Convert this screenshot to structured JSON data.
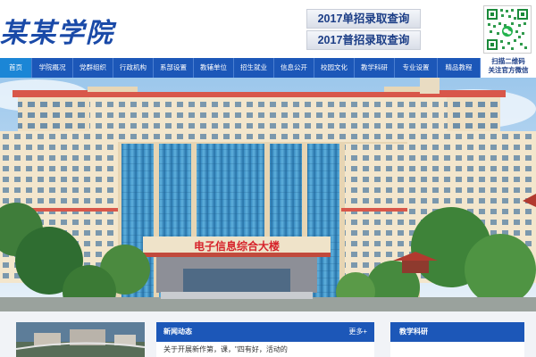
{
  "header": {
    "logo_text": "某某学院",
    "query_buttons": [
      "2017单招录取查询",
      "2017普招录取查询"
    ],
    "qr_caption_line1": "扫描二维码",
    "qr_caption_line2": "关注官方微信"
  },
  "nav": {
    "items": [
      "首页",
      "学院概况",
      "党群组织",
      "行政机构",
      "系部设置",
      "教辅单位",
      "招生就业",
      "信息公开",
      "校园文化",
      "教学科研",
      "专业设置",
      "精品教程"
    ],
    "active_index": 0
  },
  "banner": {
    "building_sign": "电子信息综合大楼"
  },
  "news": {
    "title": "新闻动态",
    "more": "更多+",
    "first_line": "关于开展新作第，课，\"四有好，活动的"
  },
  "teaching": {
    "title": "教学科研"
  },
  "colors": {
    "nav_blue": "#1c57b8",
    "nav_active": "#1b86d6",
    "accent_text": "#1b3d86"
  }
}
